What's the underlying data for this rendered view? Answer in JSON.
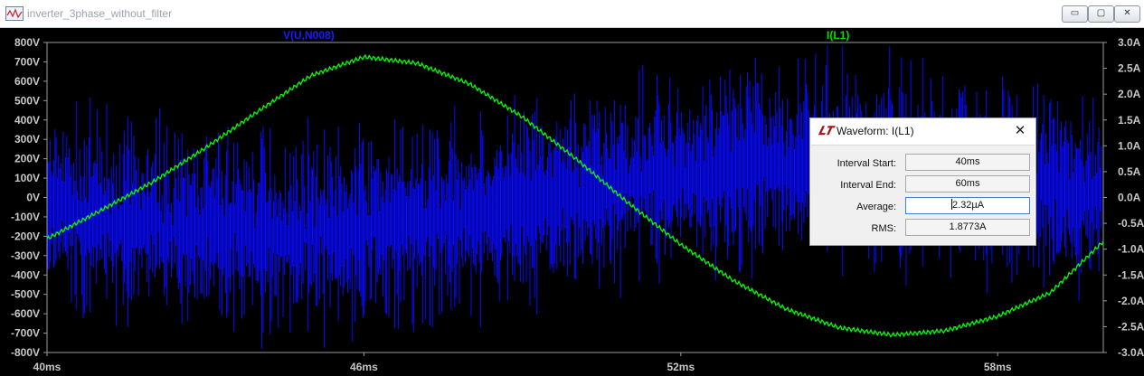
{
  "window": {
    "title": "inverter_3phase_without_filter",
    "min_glyph": "▭",
    "max_glyph": "▢",
    "close_glyph": "✕"
  },
  "chart_data": {
    "type": "line",
    "series": [
      {
        "name": "V(U,N008)",
        "axis": "left",
        "color": "#0000ff"
      },
      {
        "name": "I(L1)",
        "axis": "right",
        "color": "#00ff00",
        "x": [
          40,
          41,
          42,
          43,
          44,
          45,
          46,
          47,
          48,
          49,
          50,
          51,
          52,
          53,
          54,
          55,
          56,
          57,
          58,
          59,
          60
        ],
        "y": [
          -0.8,
          -0.26,
          0.3,
          0.96,
          1.67,
          2.36,
          2.72,
          2.6,
          2.2,
          1.56,
          0.76,
          -0.1,
          -0.91,
          -1.61,
          -2.16,
          -2.52,
          -2.66,
          -2.58,
          -2.3,
          -1.84,
          -0.85
        ]
      }
    ],
    "left_axis": {
      "ticks": [
        "800V",
        "700V",
        "600V",
        "500V",
        "400V",
        "300V",
        "200V",
        "100V",
        "0V",
        "-100V",
        "-200V",
        "-300V",
        "-400V",
        "-500V",
        "-600V",
        "-700V",
        "-800V"
      ],
      "min": -800,
      "max": 800
    },
    "right_axis": {
      "ticks": [
        "3.0A",
        "2.5A",
        "2.0A",
        "1.5A",
        "1.0A",
        "0.5A",
        "0.0A",
        "-0.5A",
        "-1.0A",
        "-1.5A",
        "-2.0A",
        "-2.5A",
        "-3.0A"
      ],
      "min": -3.0,
      "max": 3.0
    },
    "x_axis": {
      "ticks": [
        "40ms",
        "46ms",
        "52ms",
        "58ms"
      ],
      "values": [
        40,
        46,
        52,
        58
      ],
      "min": 40,
      "max": 60
    },
    "grid": false
  },
  "dialog": {
    "title": "Waveform: I(L1)",
    "icon_glyph": "𝑳𝑻",
    "close_glyph": "✕",
    "rows": [
      {
        "label": "Interval Start:",
        "value": "40ms"
      },
      {
        "label": "Interval End:",
        "value": "60ms"
      },
      {
        "label": "Average:",
        "value": "2.32µA"
      },
      {
        "label": "RMS:",
        "value": "1.8773A"
      }
    ]
  }
}
